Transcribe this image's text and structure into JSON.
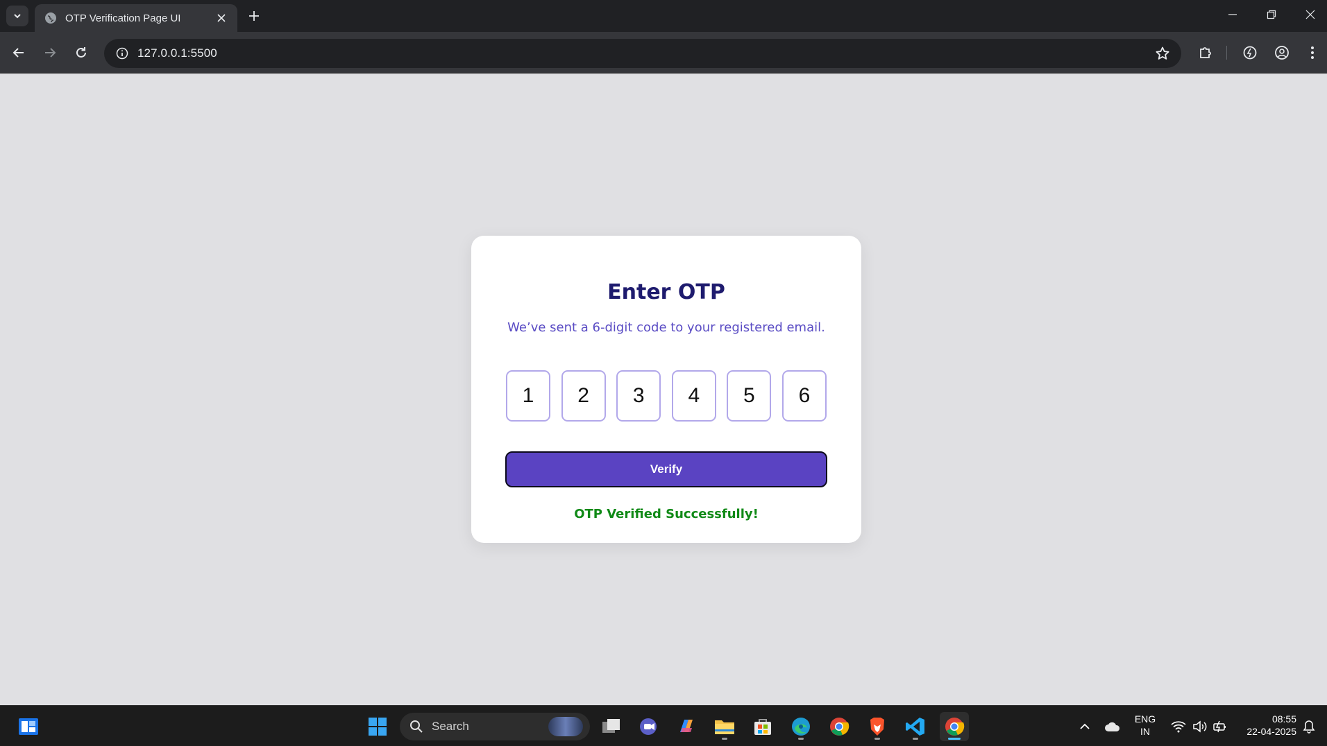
{
  "browser": {
    "tab_title": "OTP Verification Page UI",
    "url": "127.0.0.1:5500"
  },
  "page": {
    "heading": "Enter OTP",
    "subtitle": "We’ve sent a 6-digit code to your registered email.",
    "otp_digits": [
      "1",
      "2",
      "3",
      "4",
      "5",
      "6"
    ],
    "verify_label": "Verify",
    "status_message": "OTP Verified Successfully!"
  },
  "taskbar": {
    "search_label": "Search",
    "language": "ENG",
    "region": "IN",
    "time": "08:55",
    "date": "22-04-2025"
  },
  "colors": {
    "heading": "#1e1b6e",
    "subtitle": "#5a4cc4",
    "button": "#5a43c2",
    "success": "#108a17",
    "page_bg": "#e0e0e3"
  }
}
